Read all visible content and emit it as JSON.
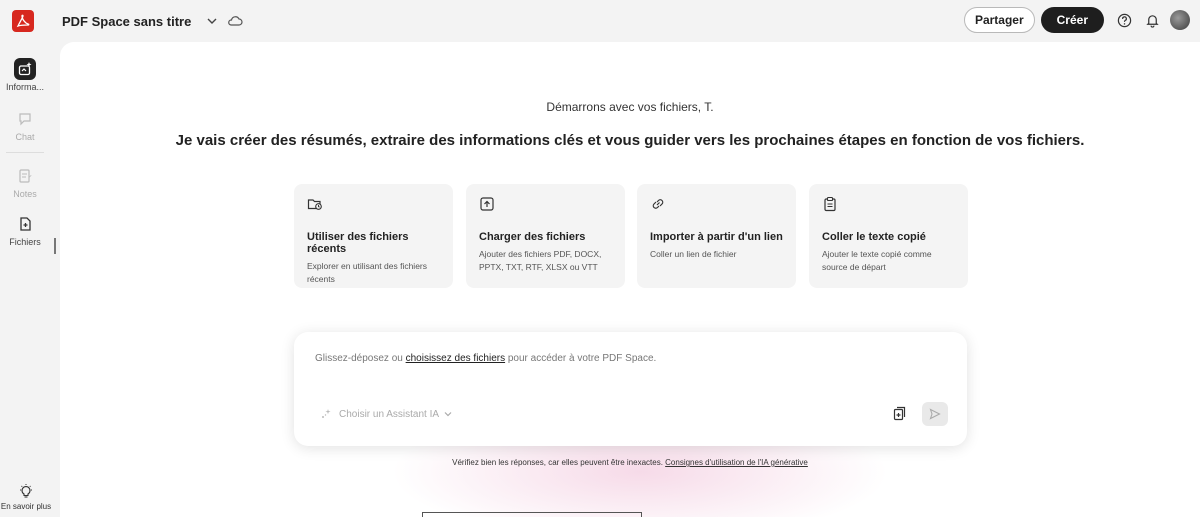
{
  "header": {
    "title": "PDF Space sans titre",
    "share_label": "Partager",
    "create_label": "Créer"
  },
  "rail": {
    "items": [
      {
        "label": "Informa...",
        "icon": "ai-sparkle-icon"
      },
      {
        "label": "Chat",
        "icon": "chat-icon"
      },
      {
        "label": "Notes",
        "icon": "notes-icon"
      },
      {
        "label": "Fichiers",
        "icon": "files-icon"
      }
    ],
    "learn_more": "En savoir plus"
  },
  "main": {
    "greeting": "Démarrons avec vos fichiers, T.",
    "headline": "Je vais créer des résumés, extraire des informations clés et vous guider vers les prochaines étapes en fonction de vos fichiers.",
    "cards": [
      {
        "title": "Utiliser des fichiers récents",
        "desc": "Explorer en utilisant des fichiers récents",
        "icon": "recent-folder-icon"
      },
      {
        "title": "Charger des fichiers",
        "desc": "Ajouter des fichiers PDF, DOCX, PPTX, TXT, RTF, XLSX ou VTT",
        "icon": "upload-icon"
      },
      {
        "title": "Importer à partir d'un lien",
        "desc": "Coller un lien de fichier",
        "icon": "link-icon"
      },
      {
        "title": "Coller le texte copié",
        "desc": "Ajouter le texte copié comme source de départ",
        "icon": "clipboard-icon"
      }
    ],
    "prompt": {
      "text_before": "Glissez-déposez ou ",
      "link": "choisissez des fichiers",
      "text_after": " pour accéder à votre PDF Space.",
      "assistant_label": "Choisir un Assistant IA"
    },
    "disclaimer": {
      "text": "Vérifiez bien les réponses, car elles peuvent être inexactes. ",
      "link": "Consignes d'utilisation de l'IA générative"
    }
  },
  "colors": {
    "accent_red": "#d7281f",
    "dark_button": "#1e1e1e",
    "background": "#f3f3f3",
    "card_bg": "#f4f4f4"
  }
}
